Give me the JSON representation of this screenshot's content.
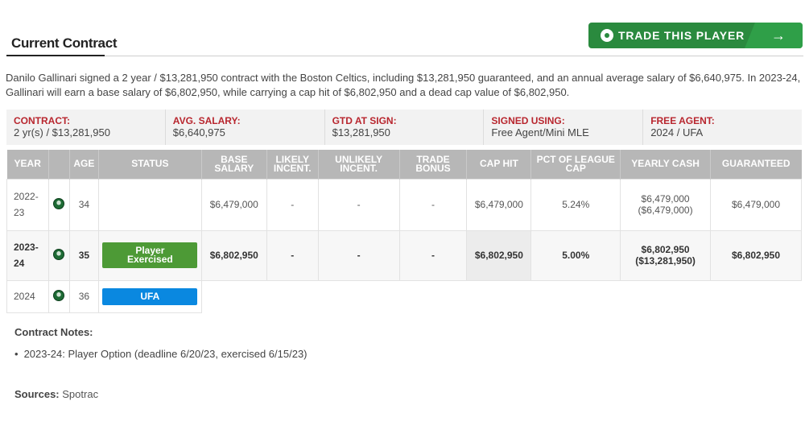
{
  "section_title": "Current Contract",
  "trade_button": {
    "label": "TRADE THIS PLAYER",
    "arrow": "→",
    "icon": "circle-badge-icon"
  },
  "summary": "Danilo Gallinari signed a 2 year / $13,281,950 contract with the Boston Celtics, including $13,281,950 guaranteed, and an annual average salary of $6,640,975. In 2023-24, Gallinari will earn a base salary of $6,802,950, while carrying a cap hit of $6,802,950 and a dead cap value of $6,802,950.",
  "info_bar": [
    {
      "label": "CONTRACT:",
      "value": "2 yr(s) / $13,281,950"
    },
    {
      "label": "AVG. SALARY:",
      "value": "$6,640,975"
    },
    {
      "label": "GTD AT SIGN:",
      "value": "$13,281,950"
    },
    {
      "label": "SIGNED USING:",
      "value": "Free Agent/Mini MLE"
    },
    {
      "label": "FREE AGENT:",
      "value": "2024 / UFA"
    }
  ],
  "table": {
    "headers": [
      "YEAR",
      "",
      "AGE",
      "STATUS",
      "BASE SALARY",
      "LIKELY INCENT.",
      "UNLIKELY INCENT.",
      "TRADE BONUS",
      "CAP HIT",
      "PCT OF LEAGUE CAP",
      "YEARLY CASH",
      "GUARANTEED"
    ],
    "rows": [
      {
        "year_a": "2022-",
        "year_b": "23",
        "age": "34",
        "status": "",
        "base_salary": "$6,479,000",
        "likely": "-",
        "unlikely": "-",
        "trade_bonus": "-",
        "cap_hit": "$6,479,000",
        "pct_cap": "5.24%",
        "yearly_cash_a": "$6,479,000",
        "yearly_cash_b": "($6,479,000)",
        "guaranteed": "$6,479,000"
      },
      {
        "year_a": "2023-",
        "year_b": "24",
        "age": "35",
        "status_a": "Player",
        "status_b": "Exercised",
        "base_salary": "$6,802,950",
        "likely": "-",
        "unlikely": "-",
        "trade_bonus": "-",
        "cap_hit": "$6,802,950",
        "pct_cap": "5.00%",
        "yearly_cash_a": "$6,802,950",
        "yearly_cash_b": "($13,281,950)",
        "guaranteed": "$6,802,950"
      },
      {
        "year": "2024",
        "age": "36",
        "status": "UFA"
      }
    ]
  },
  "notes": {
    "title": "Contract Notes:",
    "items": [
      "2023-24: Player Option (deadline 6/20/23, exercised 6/15/23)"
    ]
  },
  "sources": {
    "label": "Sources:",
    "value": "Spotrac"
  },
  "colors": {
    "accent_green": "#2a8a3e",
    "label_red": "#b8262e",
    "badge_green": "#4d9a36",
    "badge_blue": "#0a88e0",
    "header_gray": "#b7b7b7"
  }
}
